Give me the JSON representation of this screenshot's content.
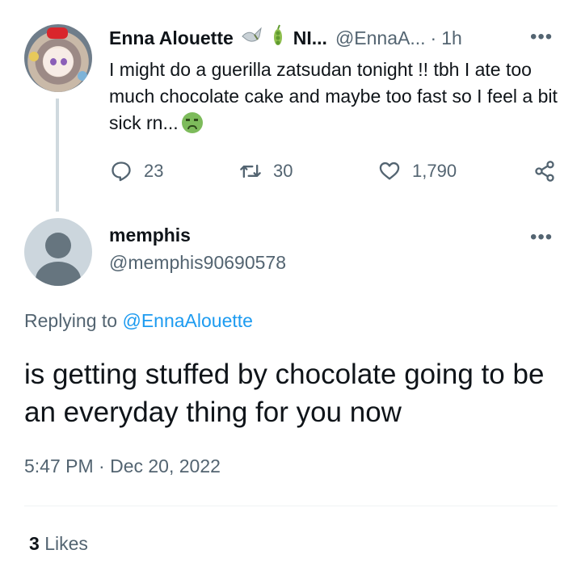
{
  "parent_tweet": {
    "name": "Enna Alouette",
    "name_emojis": [
      "dove-emoji",
      "pea-pod-emoji"
    ],
    "name_suffix": "NI...",
    "handle": "@EnnaA...",
    "separator": "·",
    "time": "1h",
    "text": "I might do a guerilla zatsudan tonight !! tbh I ate too much chocolate cake and maybe too fast so I feel a bit sick rn...",
    "text_emoji": "nauseated-face-emoji",
    "more_label": "•••",
    "replies": "23",
    "retweets": "30",
    "likes": "1,790"
  },
  "reply_tweet": {
    "name": "memphis",
    "handle": "@memphis90690578",
    "replying_label": "Replying to",
    "replying_to": "@EnnaAlouette",
    "text": "is getting stuffed by chocolate going to be an everyday thing for you now",
    "timestamp": "5:47 PM · Dec 20, 2022",
    "more_label": "•••",
    "like_count": "3",
    "like_word": "Likes"
  },
  "colors": {
    "text_primary": "#0f1419",
    "text_secondary": "#536471",
    "mention": "#1d9bf0",
    "thread_line": "#cfd9de"
  }
}
